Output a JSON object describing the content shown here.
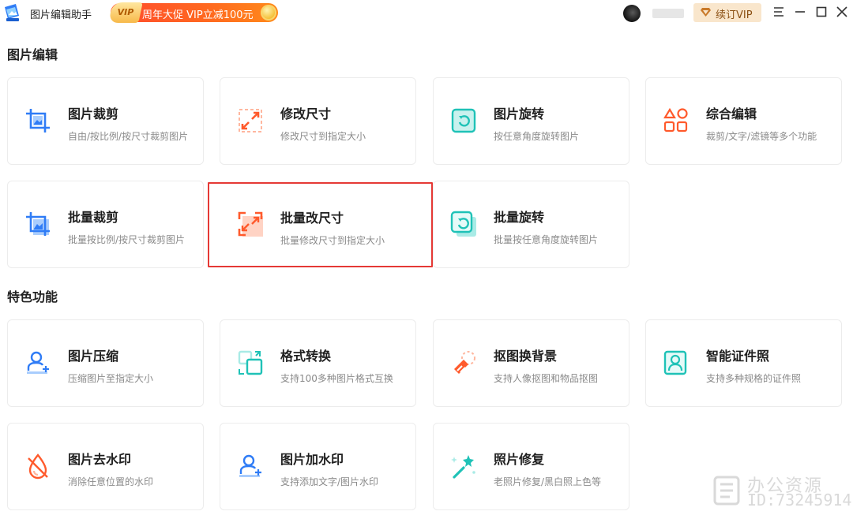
{
  "app": {
    "name": "图片编辑助手"
  },
  "promo": {
    "vip_badge": "VIP",
    "text": "周年大促 VIP立减100元"
  },
  "header": {
    "renew_label": "续订VIP"
  },
  "sections": [
    {
      "title": "图片编辑",
      "cards": [
        {
          "title": "图片裁剪",
          "desc": "自由/按比例/按尺寸裁剪图片",
          "icon": "crop-icon"
        },
        {
          "title": "修改尺寸",
          "desc": "修改尺寸到指定大小",
          "icon": "resize-icon"
        },
        {
          "title": "图片旋转",
          "desc": "按任意角度旋转图片",
          "icon": "rotate-icon"
        },
        {
          "title": "综合编辑",
          "desc": "裁剪/文字/滤镜等多个功能",
          "icon": "shapes-icon"
        },
        {
          "title": "批量裁剪",
          "desc": "批量按比例/按尺寸裁剪图片",
          "icon": "batch-crop-icon"
        },
        {
          "title": "批量改尺寸",
          "desc": "批量修改尺寸到指定大小",
          "icon": "batch-resize-icon"
        },
        {
          "title": "批量旋转",
          "desc": "批量按任意角度旋转图片",
          "icon": "batch-rotate-icon"
        }
      ]
    },
    {
      "title": "特色功能",
      "cards": [
        {
          "title": "图片压缩",
          "desc": "压缩图片至指定大小",
          "icon": "compress-icon"
        },
        {
          "title": "格式转换",
          "desc": "支持100多种图片格式互换",
          "icon": "convert-icon"
        },
        {
          "title": "抠图换背景",
          "desc": "支持人像抠图和物品抠图",
          "icon": "cutout-icon"
        },
        {
          "title": "智能证件照",
          "desc": "支持多种规格的证件照",
          "icon": "id-photo-icon"
        },
        {
          "title": "图片去水印",
          "desc": "消除任意位置的水印",
          "icon": "remove-watermark-icon"
        },
        {
          "title": "图片加水印",
          "desc": "支持添加文字/图片水印",
          "icon": "add-watermark-icon"
        },
        {
          "title": "照片修复",
          "desc": "老照片修复/黑白照上色等",
          "icon": "repair-icon"
        }
      ]
    }
  ],
  "watermark": {
    "line1": "办公资源",
    "line2": "ID:73245914"
  },
  "colors": {
    "blue": "#2f7cf6",
    "orange": "#ff5a2c",
    "teal": "#1fc2b7",
    "selected_border": "#e53935"
  }
}
